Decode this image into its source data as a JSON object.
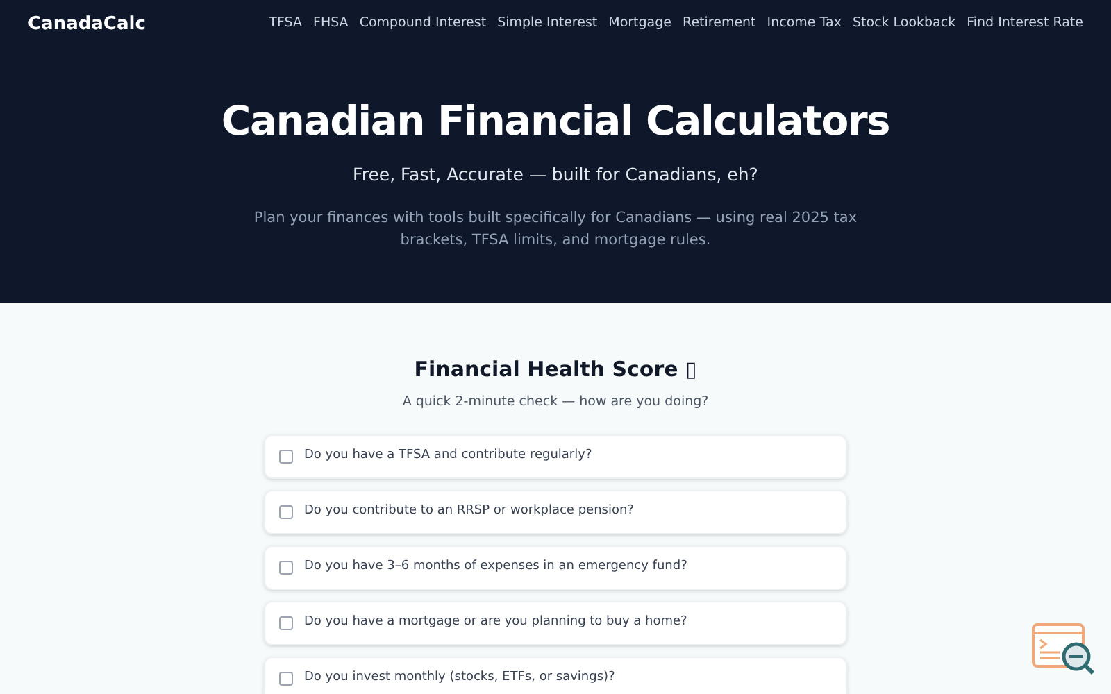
{
  "brand": "CanadaCalc",
  "nav": [
    "TFSA",
    "FHSA",
    "Compound Interest",
    "Simple Interest",
    "Mortgage",
    "Retirement",
    "Income Tax",
    "Stock Lookback",
    "Find Interest Rate"
  ],
  "hero": {
    "title": "Canadian Financial Calculators",
    "tagline": "Free, Fast, Accurate — built for Canadians, eh?",
    "description": "Plan your finances with tools built specifically for Canadians — using real 2025 tax brackets, TFSA limits, and mortgage rules."
  },
  "quiz": {
    "title": "Financial Health Score ▯",
    "subtitle": "A quick 2-minute check — how are you doing?",
    "questions": [
      {
        "text": "Do you have a TFSA and contribute regularly?",
        "checked": false
      },
      {
        "text": "Do you contribute to an RRSP or workplace pension?",
        "checked": false
      },
      {
        "text": "Do you have 3–6 months of expenses in an emergency fund?",
        "checked": false
      },
      {
        "text": "Do you have a mortgage or are you planning to buy a home?",
        "checked": false
      },
      {
        "text": "Do you invest monthly (stocks, ETFs, or savings)?",
        "checked": false
      }
    ]
  }
}
